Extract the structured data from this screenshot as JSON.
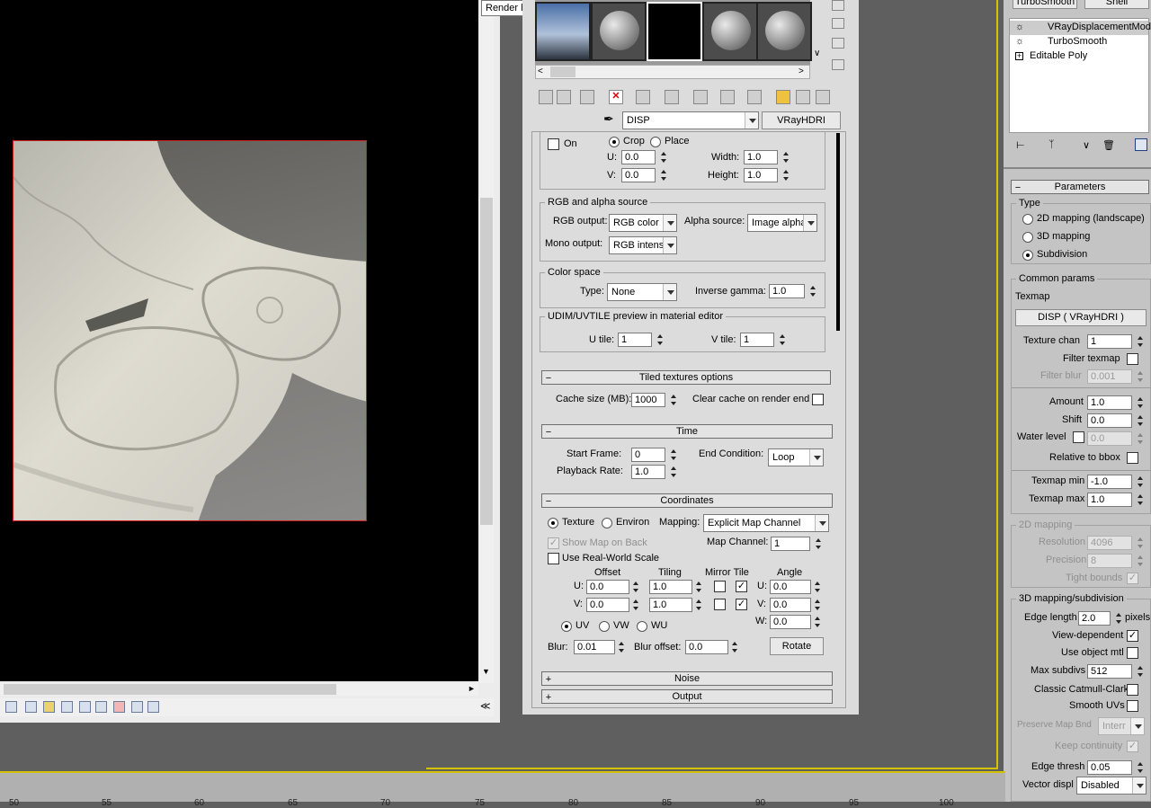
{
  "tooltip": "Render last",
  "mods_top": {
    "b1": "TurboSmooth",
    "b2": "Shell"
  },
  "modifier_stack": [
    {
      "name": "VRayDisplacementMod",
      "selected": true
    },
    {
      "name": "TurboSmooth",
      "selected": false
    },
    {
      "name": "Editable Poly",
      "selected": false
    }
  ],
  "params_title": "Parameters",
  "params": {
    "type_group": "Type",
    "type_options": [
      "2D mapping (landscape)",
      "3D mapping",
      "Subdivision"
    ],
    "type_selected": "Subdivision",
    "common_group": "Common params",
    "texmap_label": "Texmap",
    "texmap_button": "DISP ( VRayHDRI )",
    "texture_chan_label": "Texture chan",
    "texture_chan": "1",
    "filter_texmap_label": "Filter texmap",
    "filter_blur_label": "Filter blur",
    "filter_blur": "0.001",
    "amount_label": "Amount",
    "amount": "1.0",
    "shift_label": "Shift",
    "shift": "0.0",
    "water_level_label": "Water level",
    "water_level": "0.0",
    "relative_bbox_label": "Relative to bbox",
    "texmap_min_label": "Texmap min",
    "texmap_min": "-1.0",
    "texmap_max_label": "Texmap max",
    "texmap_max": "1.0",
    "mapping2d_group": "2D mapping",
    "resolution_label": "Resolution",
    "resolution": "4096",
    "precision_label": "Precision",
    "precision": "8",
    "tight_bounds_label": "Tight bounds",
    "mapping3d_group": "3D mapping/subdivision",
    "edge_length_label": "Edge length",
    "edge_length": "2.0",
    "pixels_label": "pixels",
    "view_dependent_label": "View-dependent",
    "use_object_mtl_label": "Use object mtl",
    "max_subdivs_label": "Max subdivs",
    "max_subdivs": "512",
    "classic_cc_label": "Classic Catmull-Clark",
    "smooth_uvs_label": "Smooth UVs",
    "preserve_map_label": "Preserve Map Bnd",
    "preserve_map": "Interr",
    "keep_continuity_label": "Keep continuity",
    "edge_thresh_label": "Edge thresh",
    "edge_thresh": "0.05",
    "vector_disp_label": "Vector displ",
    "vector_disp": "Disabled"
  },
  "material_editor": {
    "map_name": "DISP",
    "map_type": "VRayHDRI",
    "crop": {
      "on_label": "On",
      "crop_label": "Crop",
      "place_label": "Place",
      "u_label": "U:",
      "u": "0.0",
      "v_label": "V:",
      "v": "0.0",
      "width_label": "Width:",
      "width": "1.0",
      "height_label": "Height:",
      "height": "1.0"
    },
    "rgb_group": "RGB and alpha source",
    "rgb_output_label": "RGB output:",
    "rgb_output": "RGB color",
    "alpha_source_label": "Alpha source:",
    "alpha_source": "Image alpha",
    "mono_output_label": "Mono output:",
    "mono_output": "RGB intensi",
    "color_space_group": "Color space",
    "type_label": "Type:",
    "type_value": "None",
    "inverse_gamma_label": "Inverse gamma:",
    "inverse_gamma": "1.0",
    "udim_group": "UDIM/UVTILE preview in material editor",
    "u_tile_label": "U tile:",
    "u_tile": "1",
    "v_tile_label": "V tile:",
    "v_tile": "1",
    "tiled_rollout": "Tiled textures options",
    "cache_size_label": "Cache size (MB):",
    "cache_size": "1000",
    "clear_cache_label": "Clear cache on render end",
    "time_rollout": "Time",
    "start_frame_label": "Start Frame:",
    "start_frame": "0",
    "end_condition_label": "End Condition:",
    "end_condition": "Loop",
    "playback_rate_label": "Playback Rate:",
    "playback_rate": "1.0",
    "coords_rollout": "Coordinates",
    "texture_label": "Texture",
    "environ_label": "Environ",
    "mapping_label": "Mapping:",
    "mapping": "Explicit Map Channel",
    "show_map_label": "Show Map on Back",
    "map_channel_label": "Map Channel:",
    "map_channel": "1",
    "real_world_label": "Use Real-World Scale",
    "offset_label": "Offset",
    "tiling_label": "Tiling",
    "mirror_tile_label": "Mirror Tile",
    "angle_label": "Angle",
    "row_u_label": "U:",
    "offset_u": "0.0",
    "tiling_u": "1.0",
    "angle_u_label": "U:",
    "angle_u": "0.0",
    "row_v_label": "V:",
    "offset_v": "0.0",
    "tiling_v": "1.0",
    "angle_v_label": "V:",
    "angle_v": "0.0",
    "angle_w_label": "W:",
    "angle_w": "0.0",
    "uv_label": "UV",
    "vw_label": "VW",
    "wu_label": "WU",
    "blur_label": "Blur:",
    "blur": "0.01",
    "blur_offset_label": "Blur offset:",
    "blur_offset": "0.0",
    "rotate_button": "Rotate",
    "noise_rollout": "Noise",
    "output_rollout": "Output"
  },
  "ruler": [
    "50",
    "55",
    "60",
    "65",
    "70",
    "75",
    "80",
    "85",
    "90",
    "95",
    "100"
  ],
  "colors": {
    "viewport_border": "#d4c200",
    "render_border": "#c81e1e",
    "active_button": "#f0c040"
  }
}
